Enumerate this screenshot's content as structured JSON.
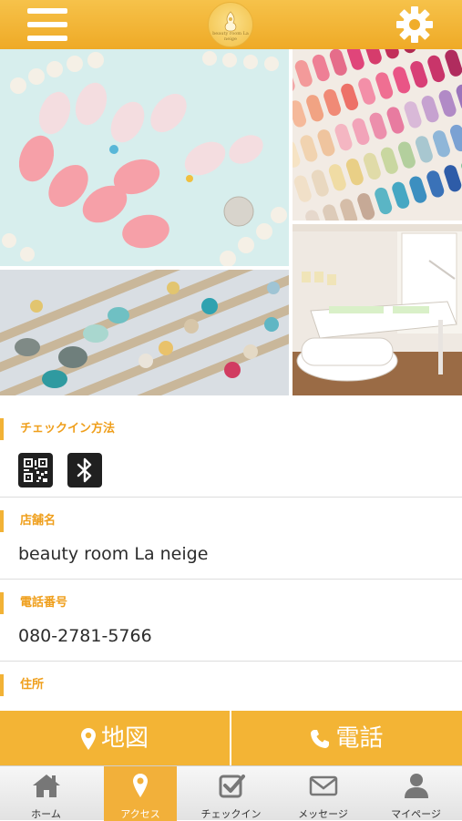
{
  "header": {
    "logo_text": "beauty room La neige"
  },
  "sections": {
    "checkin": {
      "label": "チェックイン方法"
    },
    "store": {
      "label": "店舗名",
      "value": "beauty room La neige"
    },
    "phone": {
      "label": "電話番号",
      "value": "080-2781-5766"
    },
    "address": {
      "label": "住所",
      "value": ""
    }
  },
  "actions": {
    "map_label": "地図",
    "call_label": "電話"
  },
  "tabs": [
    {
      "label": "ホーム",
      "icon": "home-icon"
    },
    {
      "label": "アクセス",
      "icon": "map-pin-icon",
      "active": true
    },
    {
      "label": "チェックイン",
      "icon": "checkin-icon"
    },
    {
      "label": "メッセージ",
      "icon": "envelope-icon"
    },
    {
      "label": "マイページ",
      "icon": "user-icon"
    }
  ],
  "colors": {
    "accent": "#f3b435",
    "label": "#ef9f1c",
    "header": "#efaa26"
  }
}
